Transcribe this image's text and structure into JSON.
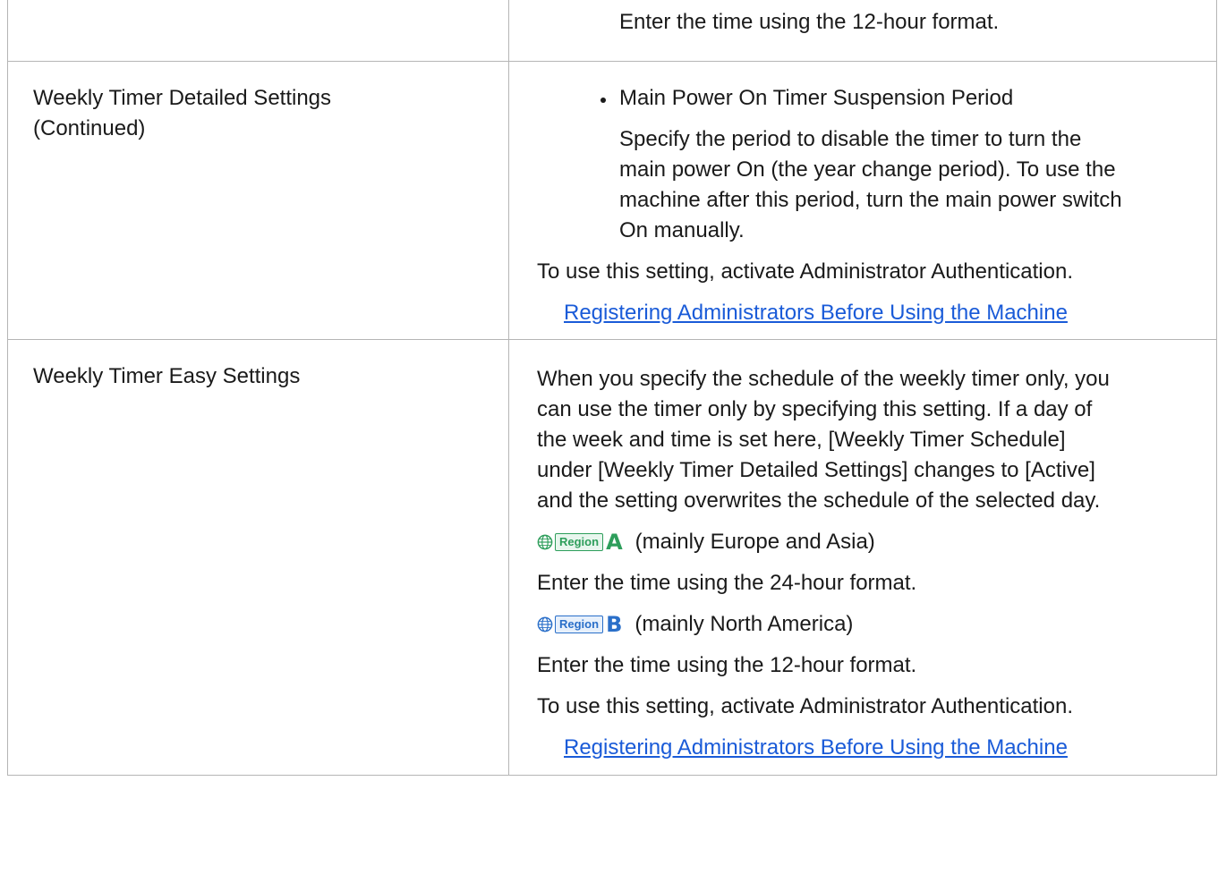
{
  "rows": [
    {
      "label_lines": [],
      "desc": {
        "indented_text": "Enter the time using the 12-hour format."
      }
    },
    {
      "label_lines": [
        "Weekly Timer Detailed Settings",
        "(Continued)"
      ],
      "desc": {
        "bullet_title": "Main Power On Timer Suspension Period",
        "bullet_body_lines": [
          "Specify the period to disable the timer to turn the",
          "main power On (the year change period). To use the",
          "machine after this period, turn the main power switch",
          "On manually."
        ],
        "admin_note": "To use this setting, activate Administrator Authentication.",
        "link": "Registering Administrators Before Using the Machine"
      }
    },
    {
      "label_lines": [
        "Weekly Timer Easy Settings"
      ],
      "desc": {
        "intro_lines": [
          "When you specify the schedule of the weekly timer only, you",
          "can use the timer only by specifying this setting. If a day of",
          "the week and time is set here, [Weekly Timer Schedule]",
          "under [Weekly Timer Detailed Settings] changes to [Active]",
          "and the setting overwrites the schedule of the selected day."
        ],
        "region_a": {
          "tag": "Region",
          "letter": "A",
          "caption": "(mainly Europe and Asia)",
          "color": "#2e9e5b"
        },
        "region_a_text": "Enter the time using the 24-hour format.",
        "region_b": {
          "tag": "Region",
          "letter": "B",
          "caption": "(mainly North America)",
          "color": "#2a6fc9"
        },
        "region_b_text": "Enter the time using the 12-hour format.",
        "admin_note": "To use this setting, activate Administrator Authentication.",
        "link": "Registering Administrators Before Using the Machine"
      }
    }
  ],
  "icons": {
    "globe": "globe-icon"
  },
  "colors": {
    "link": "#1a5bd8",
    "border": "#b5b5b5"
  }
}
